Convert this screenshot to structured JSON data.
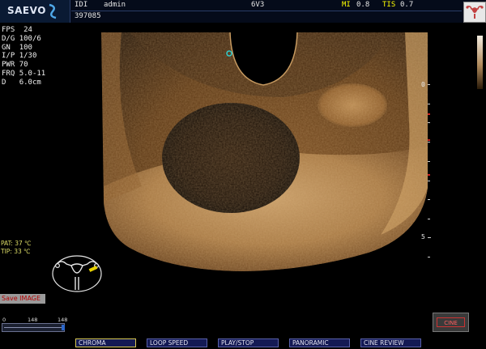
{
  "header": {
    "logo": "SAEVO",
    "user_label": "IDI",
    "user_name": "admin",
    "probe": "6V3",
    "mi_label": "MI",
    "mi_value": "0.8",
    "tis_label": "TIS",
    "tis_value": "0.7",
    "patient_id": "397085"
  },
  "params": [
    {
      "key": "FPS",
      "value": "24"
    },
    {
      "key": "D/G",
      "value": "100/6"
    },
    {
      "key": "GN",
      "value": "100"
    },
    {
      "key": "I/P",
      "value": "1/30"
    },
    {
      "key": "PWR",
      "value": "70"
    },
    {
      "key": "FRQ",
      "value": "5.0-11"
    },
    {
      "key": "D",
      "value": "6.0cm"
    }
  ],
  "temps": {
    "pat": "PAT: 37 ℃",
    "tip": "TIP: 33 ℃"
  },
  "save_button": "Save IMAGE",
  "slider": {
    "min": "0",
    "mid": "148",
    "max": "148"
  },
  "depth": {
    "zero": "0",
    "five": "5"
  },
  "cine_button": "CINE",
  "softkeys": [
    "CHROMA",
    "LOOP SPEED",
    "PLAY/STOP",
    "PANORAMIC",
    "CINE REVIEW"
  ],
  "icons": {
    "logo": "saevo-logo-icon",
    "uterus_button": "uterus-icon",
    "pictogram": "pelvic-bodymark-icon"
  },
  "colors": {
    "image_tint": "#b07a3c",
    "softkey_bg": "#141a54",
    "active_border": "#d8c850",
    "temp_text": "#dddd66"
  }
}
